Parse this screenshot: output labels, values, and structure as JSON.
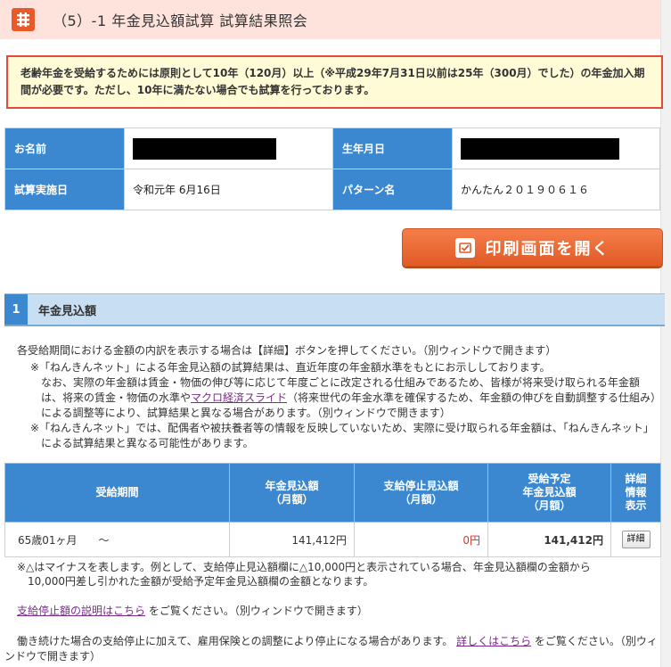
{
  "title": "（5）-1  年金見込額試算 試算結果照会",
  "notice": "老齢年金を受給するためには原則として10年（120月）以上（※平成29年7月31日以前は25年（300月）でした）の年金加入期間が必要です。ただし、10年に満たない場合でも試算を行っております。",
  "info": {
    "name_label": "お名前",
    "birth_label": "生年月日",
    "date_label": "試算実施日",
    "date_value": "令和元年 6月16日",
    "pattern_label": "パターン名",
    "pattern_value": "かんたん２０１９０６１６"
  },
  "print_button": "印刷画面を開く",
  "section": {
    "number": "1",
    "title": "年金見込額"
  },
  "desc": "各受給期間における金額の内訳を表示する場合は【詳細】ボタンを押してください。（別ウィンドウで開きます）",
  "notes": {
    "note1_head": "※「ねんきんネット」による年金見込額の試算結果は、直近年度の年金額水準をもとにお示ししております。",
    "note1_body_a": "なお、実際の年金額は賃金・物価の伸び等に応じて年度ごとに改定される仕組みであるため、皆様が将来受け取られる年金額は、将来の賃金・物価の水準や",
    "note1_link": "マクロ経済スライド",
    "note1_body_b": "（将来世代の年金水準を確保するため、年金額の伸びを自動調整する仕組み）による調整等により、試算結果と異なる場合があります。（別ウィンドウで開きます）",
    "note2": "※「ねんきんネット」では、配偶者や被扶養者等の情報を反映していないため、実際に受け取られる年金額は、「ねんきんネット」による試算結果と異なる可能性があります。"
  },
  "table": {
    "headers": {
      "period": "受給期間",
      "amount": [
        "年金見込額",
        "（月額）"
      ],
      "stop": [
        "支給停止見込額",
        "（月額）"
      ],
      "total": [
        "受給予定",
        "年金見込額",
        "（月額）"
      ],
      "detail": [
        "詳細",
        "情報",
        "表示"
      ]
    },
    "rows": [
      {
        "period": "65歳01ヶ月　　～",
        "amount": "141,412円",
        "stop": "0円",
        "total": "141,412円",
        "detail_button": "詳細"
      }
    ]
  },
  "footnote": {
    "line1": "※△はマイナスを表します。例として、支給停止見込額欄に△10,000円と表示されている場合、年金見込額欄の金額から",
    "line2": "10,000円差し引かれた金額が受給予定年金見込額欄の金額となります。"
  },
  "stop_info": {
    "link": "支給停止額の説明はこちら",
    "text": "をご覧ください。（別ウィンドウで開きます）"
  },
  "last": {
    "text_a": "働き続けた場合の支給停止に加えて、雇用保険との調整により停止になる場合があります。",
    "link": "詳しくはこちら",
    "text_b": "をご覧ください。（別ウィンドウで開きます）"
  },
  "colors": {
    "accent_blue": "#3b88d1",
    "button_orange": "#e8642e",
    "notice_border": "#e04b3e"
  }
}
